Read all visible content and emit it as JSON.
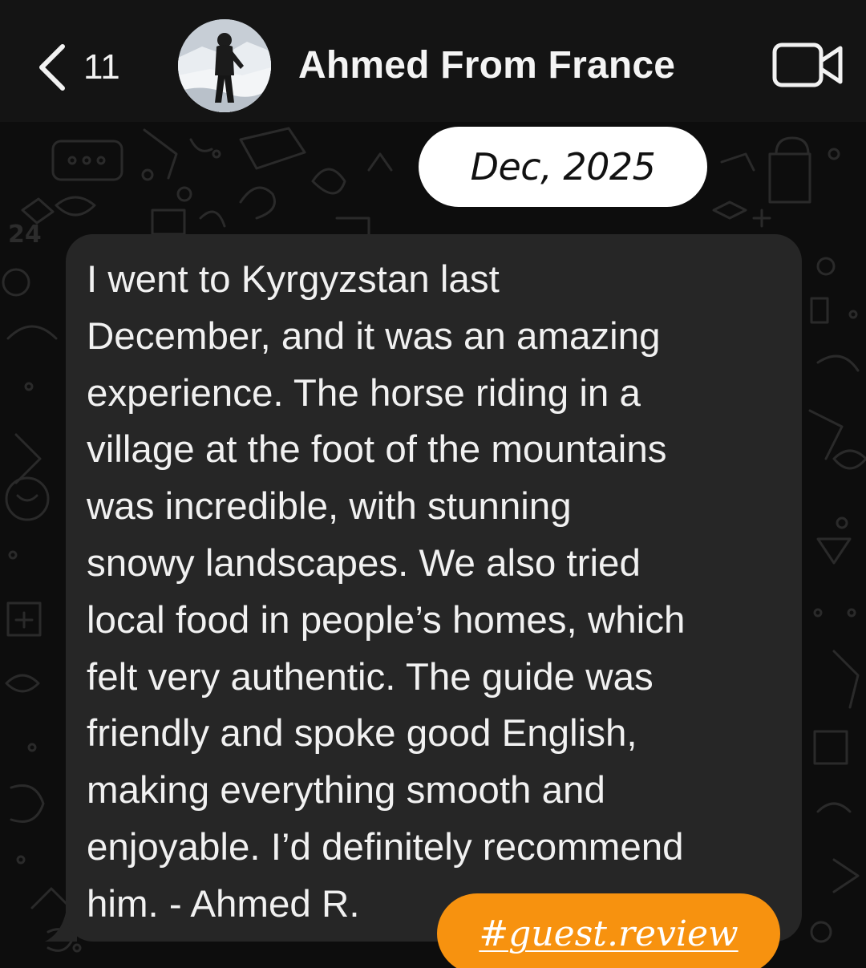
{
  "header": {
    "back_label": "back",
    "unread_count": "11",
    "contact_name": "Ahmed From France",
    "video_call_icon": "video-camera-icon"
  },
  "chat": {
    "date_separator": "Dec, 2025",
    "message": {
      "text": "I went to Kyrgyzstan last\nDecember, and it was an amazing\nexperience. The horse riding in a\nvillage at the foot of the mountains\nwas incredible, with stunning\nsnowy landscapes. We also tried\nlocal food in people’s homes, which\nfelt very authentic. The guide was\nfriendly and spoke good English,\nmaking everything smooth and\nenjoyable. I’d definitely recommend\nhim. - Ahmed R."
    },
    "hashtag": "#guest.review"
  },
  "colors": {
    "header_bg": "#141414",
    "chat_bg": "#0d0d0d",
    "bubble_bg": "#262626",
    "text": "#f1f1f1",
    "date_chip_bg": "#ffffff",
    "hashtag_bg": "#f7920f"
  }
}
